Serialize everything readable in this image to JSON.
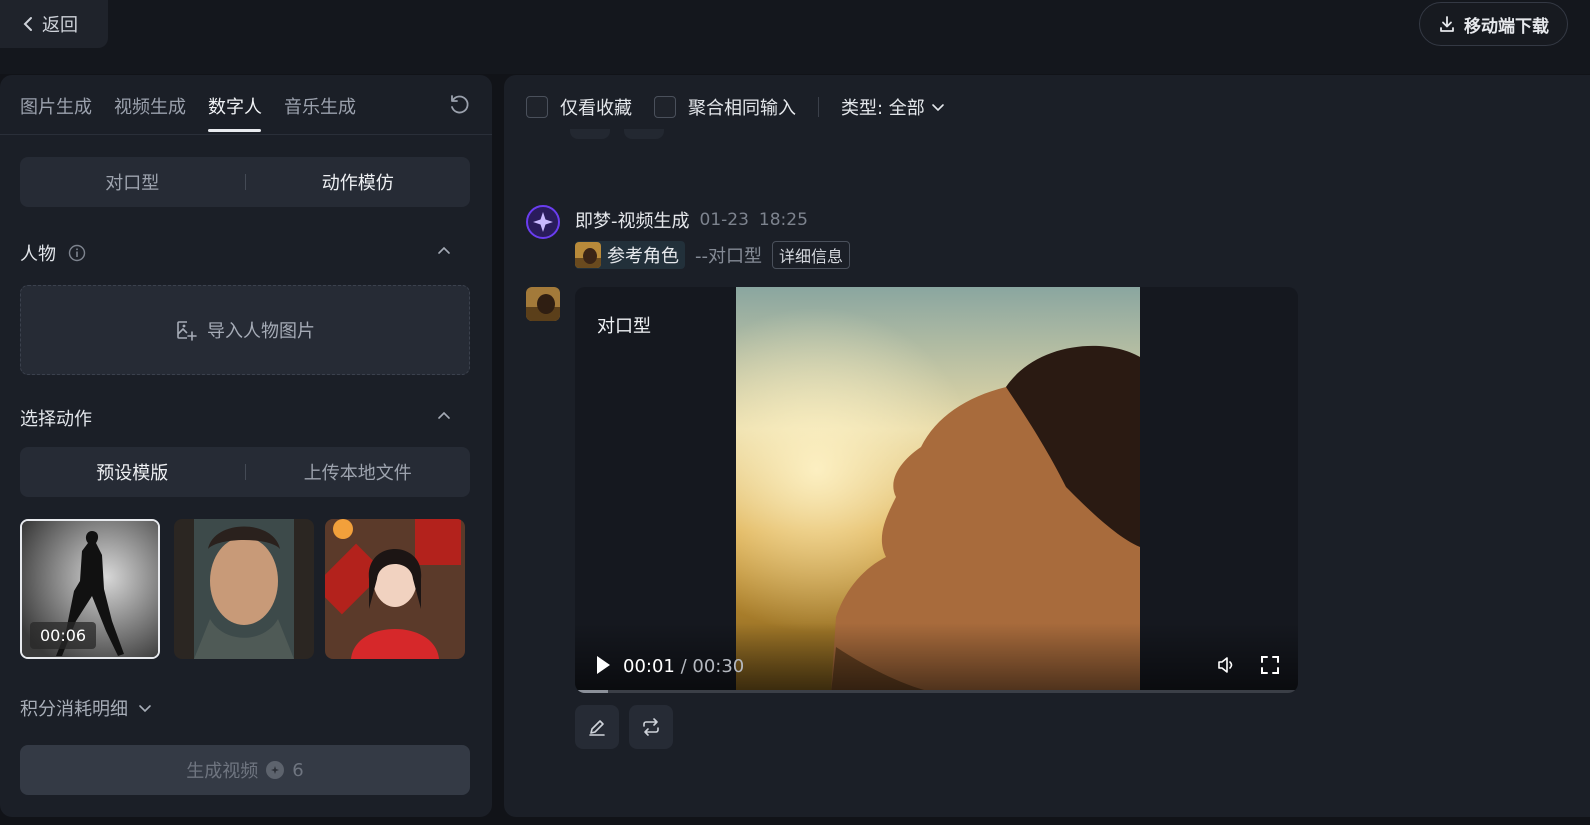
{
  "topbar": {
    "back_label": "返回",
    "download_label": "移动端下载"
  },
  "left": {
    "tabs": [
      "图片生成",
      "视频生成",
      "数字人",
      "音乐生成"
    ],
    "active_tab": 2,
    "mode_segment": [
      "对口型",
      "动作模仿"
    ],
    "person_section": "人物",
    "import_label": "导入人物图片",
    "action_section": "选择动作",
    "action_segment": [
      "预设模版",
      "上传本地文件"
    ],
    "thumbs": [
      {
        "duration": "00:06",
        "label": ""
      },
      {
        "label": ""
      },
      {
        "label": ""
      }
    ],
    "credits_label": "积分消耗明细",
    "generate_label": "生成视频",
    "generate_cost": "6"
  },
  "right": {
    "filters": {
      "favorites": "仅看收藏",
      "merge": "聚合相同输入",
      "type": "类型: 全部"
    },
    "entry": {
      "title": "即梦-视频生成",
      "date": "01-23",
      "time": "18:25",
      "ref_label": "参考角色",
      "type": "--对口型",
      "detail": "详细信息"
    },
    "video": {
      "label": "对口型",
      "current": "00:01",
      "separator": " / ",
      "duration": "00:30",
      "progress": 0.045
    }
  },
  "colors": {
    "bg": "#111318",
    "panel": "#1b1f27",
    "accent": "#6a3df0"
  }
}
